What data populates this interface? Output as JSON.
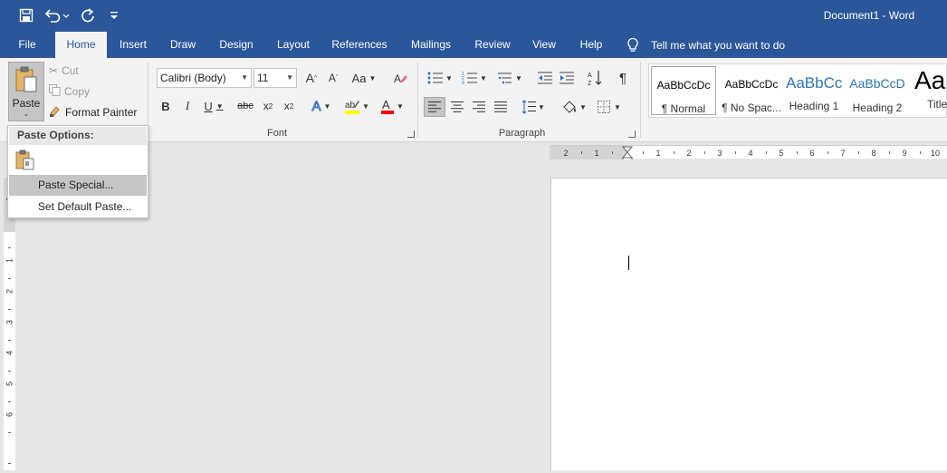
{
  "title_bar": {
    "document_title": "Document1 - Word",
    "qat": {
      "save": "save-icon",
      "undo": "undo-icon",
      "redo": "redo-icon",
      "customize": "customize-qat-icon"
    }
  },
  "tabs": {
    "file": "File",
    "home": "Home",
    "insert": "Insert",
    "draw": "Draw",
    "design": "Design",
    "layout": "Layout",
    "references": "References",
    "mailings": "Mailings",
    "review": "Review",
    "view": "View",
    "help": "Help"
  },
  "tell_me": "Tell me what you want to do",
  "clipboard": {
    "paste": "Paste",
    "cut": "Cut",
    "copy": "Copy",
    "format_painter": "Format Painter"
  },
  "font": {
    "name": "Calibri (Body)",
    "size": "11",
    "group_label": "Font",
    "change_case": "Aa"
  },
  "paragraph": {
    "group_label": "Paragraph"
  },
  "styles": [
    {
      "sample": "AaBbCcDc",
      "name": "¶ Normal"
    },
    {
      "sample": "AaBbCcDc",
      "name": "¶ No Spac..."
    },
    {
      "sample": "AaBbCc",
      "name": "Heading 1"
    },
    {
      "sample": "AaBbCcD",
      "name": "Heading 2"
    },
    {
      "sample": "Aa",
      "name": "Title"
    }
  ],
  "ruler": {
    "h_labels": [
      "2",
      "1",
      "1",
      "2",
      "3",
      "4",
      "5",
      "6",
      "7",
      "8",
      "9",
      "10"
    ],
    "v_labels": [
      "1",
      "1",
      "2",
      "3",
      "4",
      "5",
      "6"
    ]
  },
  "paste_menu": {
    "title": "Paste Options:",
    "items": [
      "Paste Special...",
      "Set Default Paste..."
    ]
  },
  "colors": {
    "brand": "#2b579a",
    "ribbon": "#f3f3f3",
    "canvas": "#e6e6e6",
    "highlight": "#ffff00",
    "font_color": "#ff0000"
  }
}
